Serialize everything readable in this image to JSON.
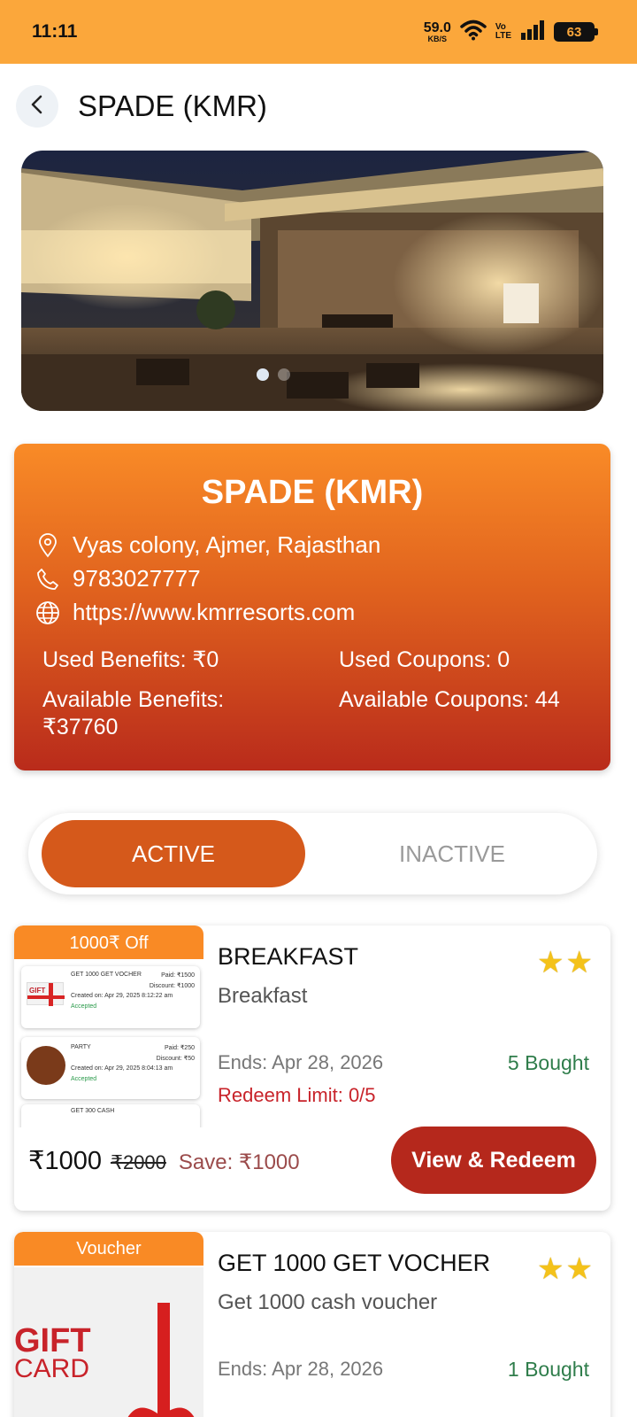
{
  "status_bar": {
    "time": "11:11",
    "speed_value": "59.0",
    "speed_unit": "KB/S",
    "volte_top": "Vo",
    "volte_bottom": "LTE",
    "battery": "63"
  },
  "header": {
    "title": "SPADE (KMR)"
  },
  "outlet": {
    "name": "SPADE (KMR)",
    "address": "Vyas colony, Ajmer, Rajasthan",
    "phone": "9783027777",
    "website": "https://www.kmrresorts.com",
    "used_benefits": "Used Benefits: ₹0",
    "used_coupons": "Used Coupons: 0",
    "available_benefits_label": "Available Benefits:",
    "available_benefits_value": "₹37760",
    "available_coupons": "Available Coupons: 44"
  },
  "tabs": {
    "active": "ACTIVE",
    "inactive": "INACTIVE"
  },
  "deals": [
    {
      "badge": "1000₹ Off",
      "title": "BREAKFAST",
      "stars": "★★",
      "description": "Breakfast",
      "ends": "Ends: Apr 28, 2026",
      "bought": "5 Bought",
      "redeem_limit": "Redeem Limit: 0/5",
      "price": "₹1000",
      "original_price": "₹2000",
      "save": "Save: ₹1000",
      "button": "View & Redeem",
      "thumb_rows": [
        {
          "title": "GET 1000 GET VOCHER",
          "paid": "Paid: ₹1500",
          "discount": "Discount: ₹1000",
          "created": "Created on: Apr 29, 2025 8:12:22 am",
          "status": "Accepted"
        },
        {
          "title": "PARTY",
          "paid": "Paid: ₹250",
          "discount": "Discount: ₹50",
          "created": "Created on: Apr 29, 2025 8:04:13 am",
          "status": "Accepted"
        },
        {
          "title": "GET 300 CASH",
          "paid": "",
          "discount": "",
          "created": "",
          "status": ""
        }
      ]
    },
    {
      "badge": "Voucher",
      "title": "GET 1000 GET VOCHER",
      "stars": "★★",
      "description": "Get 1000 cash voucher",
      "ends": "Ends: Apr 28, 2026",
      "bought": "1 Bought",
      "gift_line1": "GIFT",
      "gift_line2": "CARD"
    }
  ],
  "colors": {
    "status_bar": "#fba73b",
    "card_top": "#f98b27",
    "card_bottom": "#b92b1b",
    "tab_active": "#d5591b",
    "redeem_button": "#b5281c",
    "badge": "#f98a25"
  }
}
